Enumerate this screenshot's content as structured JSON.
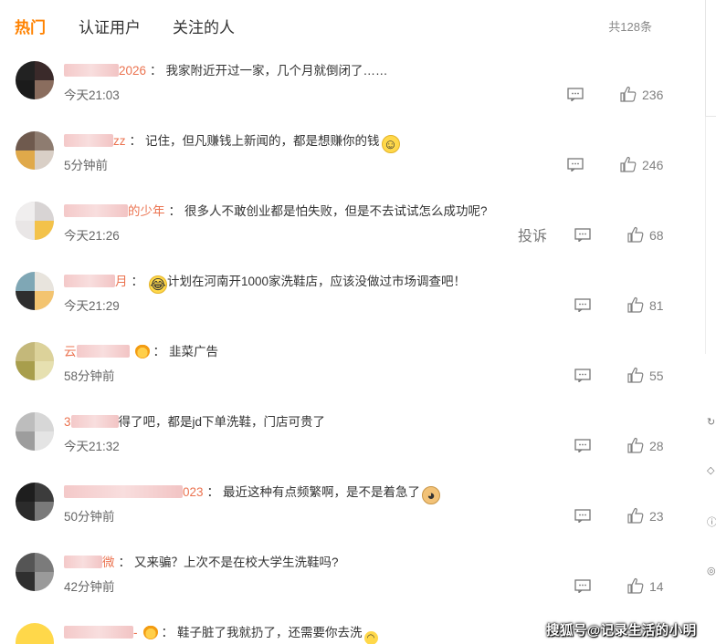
{
  "tabs": [
    {
      "label": "热门",
      "active": true
    },
    {
      "label": "认证用户",
      "active": false
    },
    {
      "label": "关注的人",
      "active": false
    }
  ],
  "total_count": "共128条",
  "report_label": "投诉",
  "accent_color": "#ff8200",
  "username_color": "#eb7350",
  "comments": [
    {
      "user_suffix": "2026",
      "text": "我家附近开过一家，几个月就倒闭了……",
      "emoji": "",
      "time": "今天21:03",
      "likes": "236"
    },
    {
      "user_suffix": "zz",
      "text": "记住，但凡赚钱上新闻的，都是想赚你的钱",
      "emoji": "smile",
      "time": "5分钟前",
      "likes": "246"
    },
    {
      "user_suffix": "的少年",
      "text": "很多人不敢创业都是怕失败，但是不去试试怎么成功呢?",
      "emoji": "",
      "time": "今天21:26",
      "likes": "68"
    },
    {
      "user_suffix": "月",
      "text": "计划在河南开1000家洗鞋店，应该没做过市场调查吧！",
      "emoji": "laugh",
      "time": "今天21:29",
      "likes": "81"
    },
    {
      "user_suffix": "云",
      "text": "韭菜广告",
      "emoji": "",
      "time": "58分钟前",
      "likes": "55"
    },
    {
      "user_suffix": "3",
      "text": "得了吧，都是jd下单洗鞋，门店可贵了",
      "emoji": "",
      "time": "今天21:32",
      "likes": "28"
    },
    {
      "user_suffix": "023",
      "text": "最近这种有点频繁啊，是不是着急了",
      "emoji": "doge",
      "time": "50分钟前",
      "likes": "23"
    },
    {
      "user_suffix": "微",
      "text": "又来骗？上次不是在校大学生洗鞋吗?",
      "emoji": "",
      "time": "42分钟前",
      "likes": "14"
    },
    {
      "user_suffix": "-",
      "text": "鞋子脏了我就扔了，还需要你去洗",
      "emoji": "tiny",
      "time": "",
      "likes": ""
    }
  ],
  "watermark": "搜狐号@记录生活的小明"
}
